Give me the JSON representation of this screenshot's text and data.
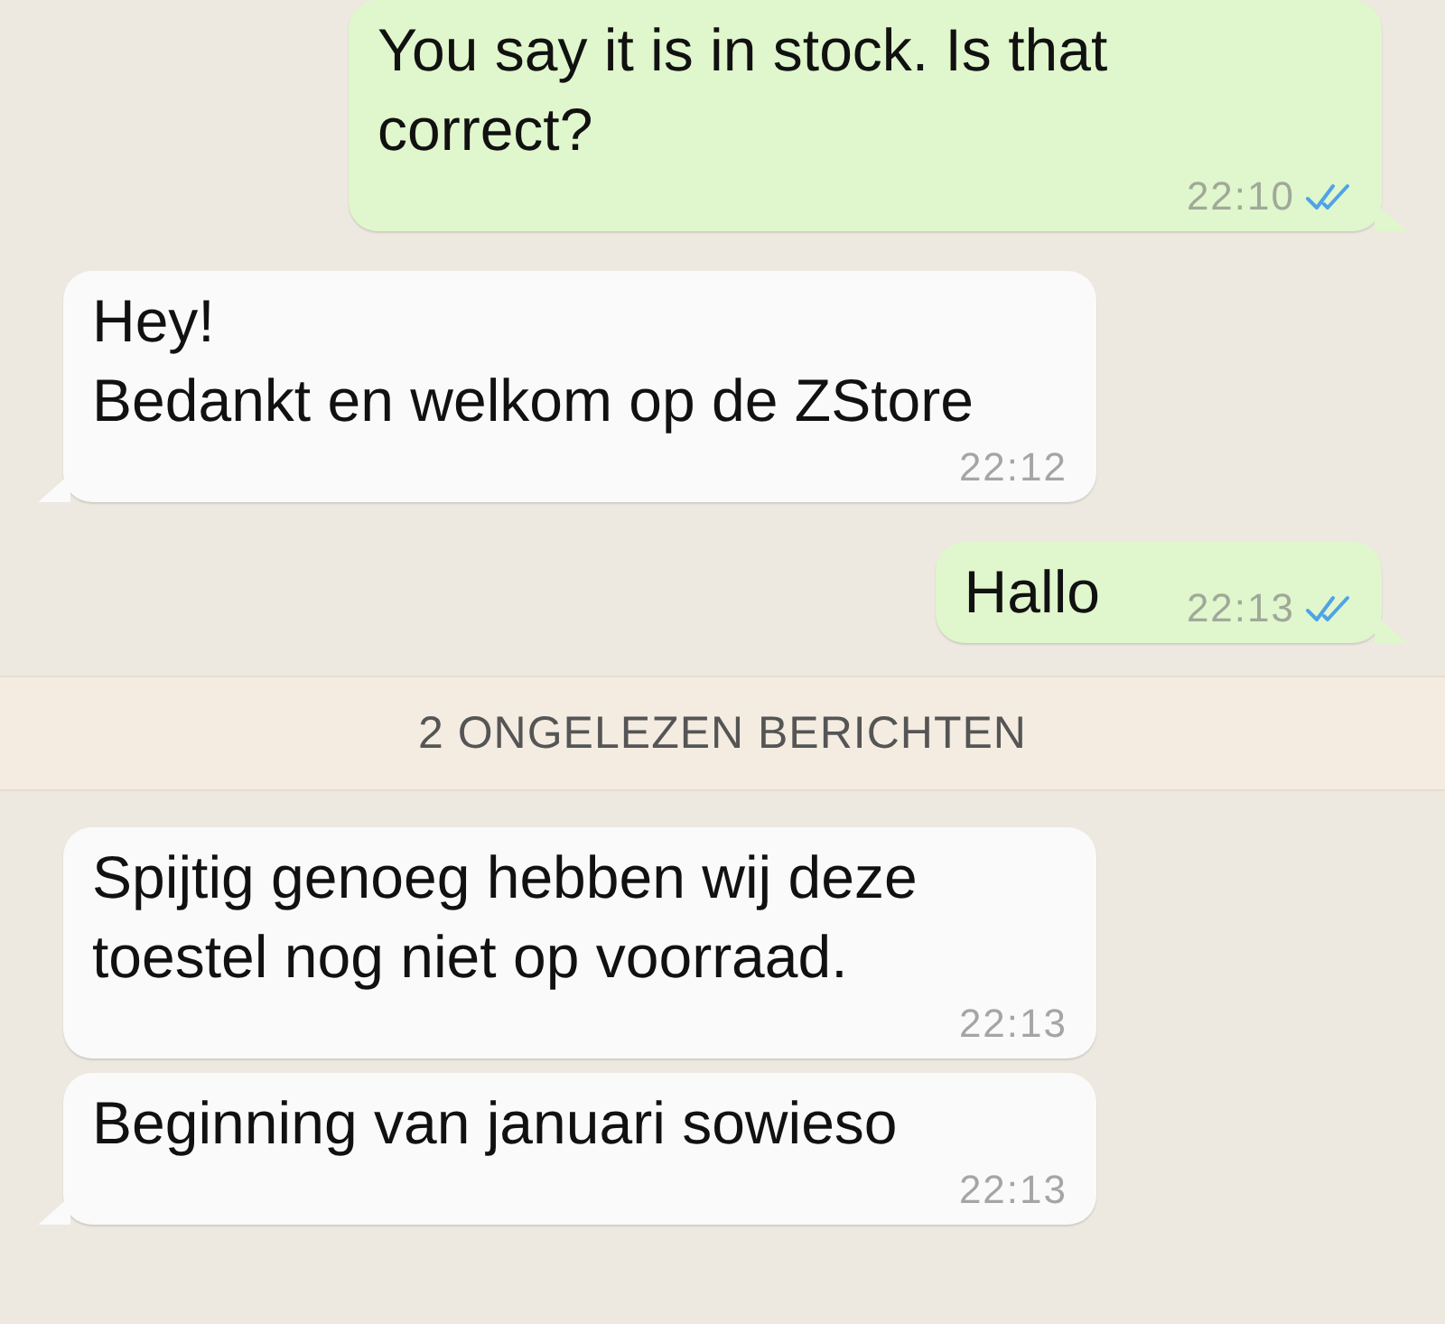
{
  "messages": [
    {
      "kind": "sent",
      "text": "You say it is in stock. Is that\ncorrect?",
      "time": "22:10",
      "read": true,
      "tail": true
    },
    {
      "kind": "received",
      "text": "Hey!\nBedankt en welkom op de ZStore",
      "time": "22:12",
      "tail": true
    },
    {
      "kind": "sent",
      "text": "Hallo",
      "time": "22:13",
      "read": true,
      "tail": true
    },
    {
      "kind": "divider",
      "text": "2 ONGELEZEN BERICHTEN"
    },
    {
      "kind": "received",
      "text": "Spijtig genoeg hebben wij deze\ntoestel nog niet op voorraad.",
      "time": "22:13",
      "tail": false
    },
    {
      "kind": "received",
      "text": "Beginning van januari sowieso",
      "time": "22:13",
      "tail": true
    }
  ]
}
